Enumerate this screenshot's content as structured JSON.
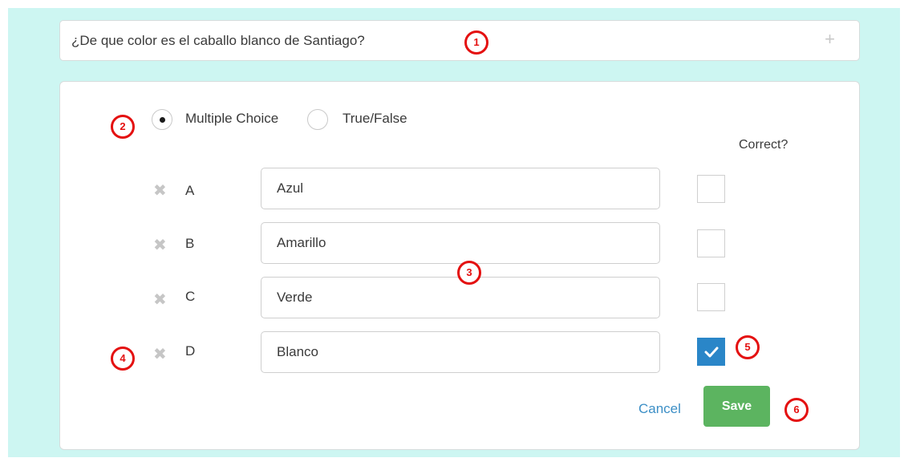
{
  "question": {
    "text": "¿De que color es el caballo blanco de Santiago?",
    "add_icon": "plus-icon"
  },
  "type_selector": {
    "options": [
      {
        "label": "Multiple Choice",
        "selected": true
      },
      {
        "label": "True/False",
        "selected": false
      }
    ]
  },
  "answers": {
    "correct_header": "Correct?",
    "remove_icon": "close-x-icon",
    "items": [
      {
        "letter": "A",
        "value": "Azul",
        "correct": false
      },
      {
        "letter": "B",
        "value": "Amarillo",
        "correct": false
      },
      {
        "letter": "C",
        "value": "Verde",
        "correct": false
      },
      {
        "letter": "D",
        "value": "Blanco",
        "correct": true
      }
    ]
  },
  "actions": {
    "cancel_label": "Cancel",
    "save_label": "Save"
  },
  "annotations": {
    "markers": [
      "1",
      "2",
      "3",
      "4",
      "5",
      "6"
    ],
    "color": "#e41010"
  },
  "colors": {
    "background": "#cdf6f2",
    "accent_blue": "#2a86c8",
    "save_green": "#5cb460",
    "link_blue": "#3c8fc6"
  }
}
